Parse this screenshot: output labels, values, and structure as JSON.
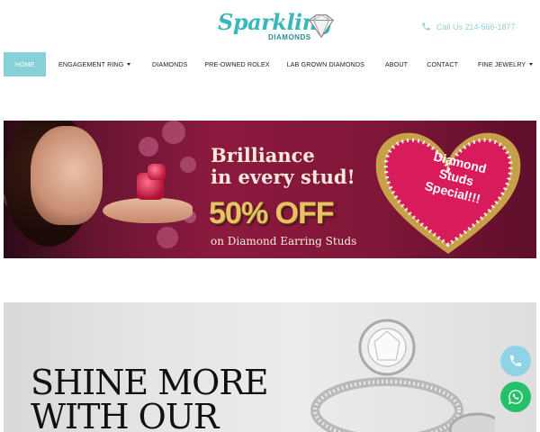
{
  "header": {
    "logo_script": "Sparkling",
    "logo_sub": "DIAMONDS",
    "phone_text": "Call Us 214-566-1877"
  },
  "nav": {
    "items": [
      {
        "label": "HOME",
        "active": true,
        "dropdown": false
      },
      {
        "label": "ENGAGEMENT RING",
        "active": false,
        "dropdown": true
      },
      {
        "label": "DIAMONDS",
        "active": false,
        "dropdown": false
      },
      {
        "label": "PRE-OWNED ROLEX",
        "active": false,
        "dropdown": false
      },
      {
        "label": "LAB GROWN DIAMONDS",
        "active": false,
        "dropdown": false
      },
      {
        "label": "ABOUT",
        "active": false,
        "dropdown": false
      },
      {
        "label": "CONTACT",
        "active": false,
        "dropdown": false
      },
      {
        "label": "FINE JEWELRY",
        "active": false,
        "dropdown": true
      }
    ]
  },
  "banner": {
    "line1": "Brilliance",
    "line2": "in every stud!",
    "offer": "50% OFF",
    "subline": "on Diamond Earring Studs",
    "heart_line1": "Diamond",
    "heart_line2": "Studs",
    "heart_line3": "Special!!!"
  },
  "hero": {
    "title_line1": "SHINE MORE",
    "title_line2": "WITH OUR"
  },
  "floating": {
    "call_icon": "phone-icon",
    "whatsapp_icon": "whatsapp-icon"
  },
  "colors": {
    "brand_teal": "#3bb6bd",
    "nav_active": "#86d0d7",
    "banner_bg": "#8c1a3f",
    "offer_gold": "#e7c165",
    "whatsapp_green": "#27c06a",
    "call_blue": "#8ed3e6"
  }
}
